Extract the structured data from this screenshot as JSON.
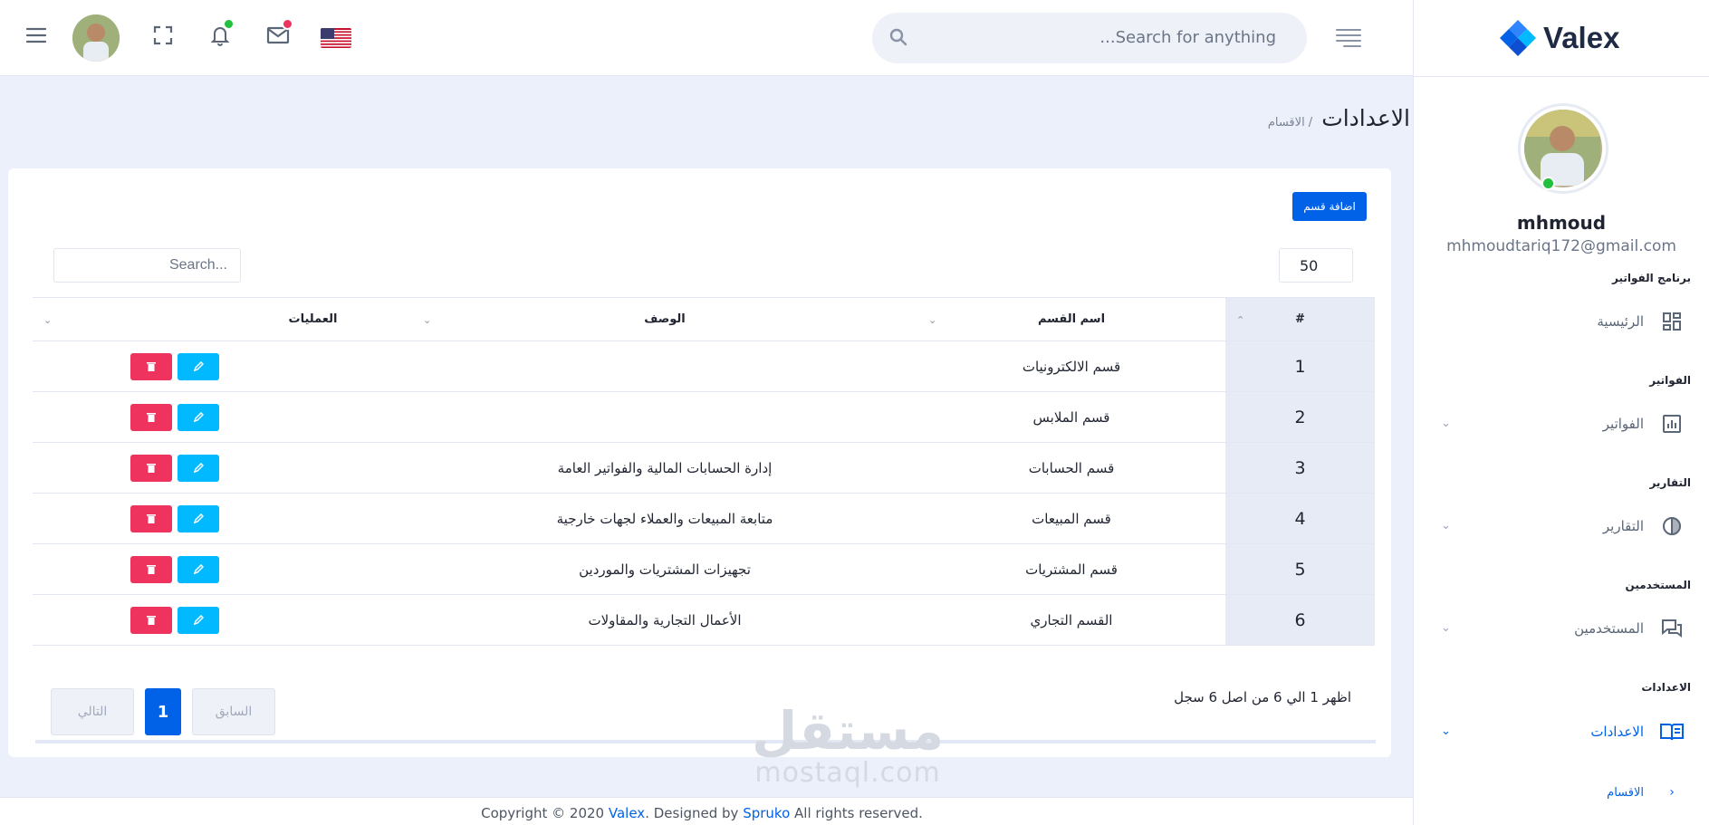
{
  "header": {
    "search_placeholder": "...Search for anything",
    "menu_icon": "hamburger-icon",
    "fullscreen_icon": "fullscreen-icon",
    "bell_icon": "bell-icon",
    "mail_icon": "mail-icon",
    "flag_icon": "us-flag-icon",
    "notification_dot_color": "#22c03c",
    "mail_dot_color": "#ee335e"
  },
  "sidebar": {
    "logo_text": "Valex",
    "user_name": "mhmoud",
    "user_email": "mhmoudtariq172@gmail.com",
    "sections": [
      {
        "category": "برنامج الفواتير",
        "item": "الرئيسية",
        "icon": "dashboard-icon"
      },
      {
        "category": "الفواتير",
        "item": "الفواتير",
        "icon": "chart-icon"
      },
      {
        "category": "التقارير",
        "item": "التقارير",
        "icon": "pie-icon"
      },
      {
        "category": "المستخدمين",
        "item": "المستخدمين",
        "icon": "chat-icon"
      },
      {
        "category": "الاعدادات",
        "item": "الاعدادات",
        "icon": "book-icon"
      }
    ],
    "sub_item": "الاقسام"
  },
  "page": {
    "title": "الاعدادات",
    "breadcrumb_sub": "/ الاقسام",
    "add_button": "اضافة قسم",
    "page_length": "50",
    "table_search_placeholder": "Search...",
    "columns": [
      "#",
      "اسم القسم",
      "الوصف",
      "العمليات"
    ],
    "rows": [
      {
        "num": "1",
        "name": "قسم الالكترونيات",
        "desc": ""
      },
      {
        "num": "2",
        "name": "قسم الملابس",
        "desc": ""
      },
      {
        "num": "3",
        "name": "قسم الحسابات",
        "desc": "إدارة الحسابات المالية والفواتير العامة"
      },
      {
        "num": "4",
        "name": "قسم المبيعات",
        "desc": "متابعة المبيعات والعملاء لجهات خارجية"
      },
      {
        "num": "5",
        "name": "قسم المشتريات",
        "desc": "تجهيزات المشتريات والموردين"
      },
      {
        "num": "6",
        "name": "القسم التجاري",
        "desc": "الأعمال التجارية والمقاولات"
      }
    ],
    "info_text": "اظهر 1 الي 6 من اصل 6 سجل",
    "pager": {
      "prev": "السابق",
      "current": "1",
      "next": "التالي"
    }
  },
  "watermark": {
    "arabic": "مستقل",
    "latin": "mostaql.com"
  },
  "footer": {
    "prefix": "Copyright © 2020 ",
    "brand": "Valex",
    "middle": ". Designed by ",
    "author": "Spruko",
    "suffix": " All rights reserved."
  },
  "colors": {
    "primary": "#0162e8",
    "edit": "#00b9ff",
    "delete": "#ee335e",
    "online": "#22c03c"
  }
}
